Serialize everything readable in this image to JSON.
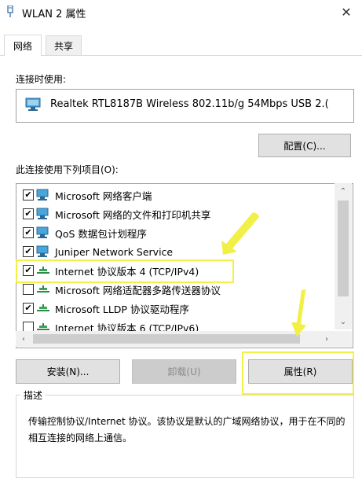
{
  "window": {
    "title": "WLAN 2 属性",
    "close_glyph": "✕"
  },
  "tabs": [
    {
      "label": "网络",
      "active": true
    },
    {
      "label": "共享",
      "active": false
    }
  ],
  "connect_using": {
    "label": "连接时使用:",
    "adapter": "Realtek RTL8187B Wireless 802.11b/g 54Mbps USB 2.(",
    "configure_button": "配置(C)..."
  },
  "items_section": {
    "label": "此连接使用下列项目(O):",
    "items": [
      {
        "label": "Microsoft 网络客户端",
        "checked": true,
        "icon": "network-client-icon"
      },
      {
        "label": "Microsoft 网络的文件和打印机共享",
        "checked": true,
        "icon": "file-sharing-icon"
      },
      {
        "label": "QoS 数据包计划程序",
        "checked": true,
        "icon": "qos-icon"
      },
      {
        "label": "Juniper Network Service",
        "checked": true,
        "icon": "network-service-icon"
      },
      {
        "label": "Internet 协议版本 4 (TCP/IPv4)",
        "checked": true,
        "icon": "protocol-icon",
        "highlighted": true
      },
      {
        "label": "Microsoft 网络适配器多路传送器协议",
        "checked": false,
        "icon": "protocol-icon"
      },
      {
        "label": "Microsoft LLDP 协议驱动程序",
        "checked": true,
        "icon": "protocol-icon"
      },
      {
        "label": "Internet 协议版本 6 (TCP/IPv6)",
        "checked": false,
        "icon": "protocol-icon"
      }
    ]
  },
  "buttons": {
    "install": "安装(N)...",
    "uninstall": "卸载(U)",
    "properties": "属性(R)"
  },
  "description": {
    "legend": "描述",
    "text": "传输控制协议/Internet 协议。该协议是默认的广域网络协议，用于在不同的相互连接的网络上通信。"
  },
  "colors": {
    "highlight": "#f4f04a",
    "button_bg": "#e1e1e1",
    "disabled_button_bg": "#cccccc"
  }
}
